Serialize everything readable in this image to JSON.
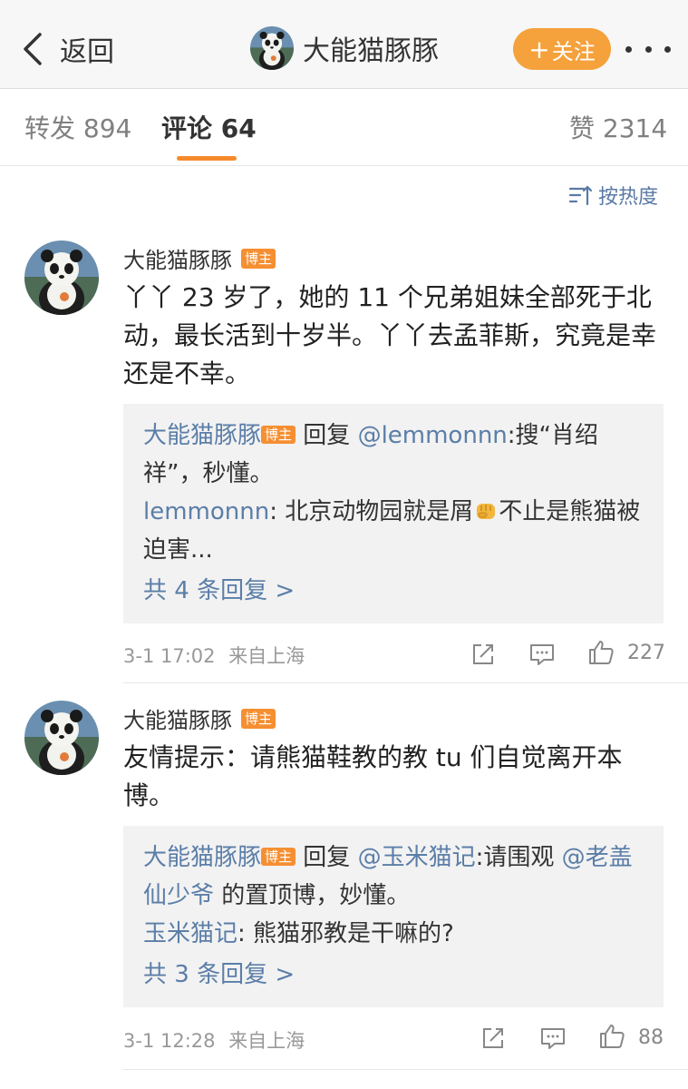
{
  "nav": {
    "back_label": "返回",
    "title": "大能猫豚豚",
    "follow_label": "关注",
    "follow_icon": "plus-icon",
    "more_icon": "more-icon"
  },
  "tabs": {
    "repost": "转发 894",
    "comment": "评论 64",
    "like": "赞 2314"
  },
  "sort": {
    "label": "按热度",
    "icon": "sort-icon"
  },
  "colors": {
    "accent": "#f5a13c",
    "link": "#5b7ea8",
    "badge": "#f68f32"
  },
  "comments": [
    {
      "author": "大能猫豚豚",
      "badge": "博主",
      "text": "丫丫 23 岁了，她的 11 个兄弟姐妹全部死于北动，最长活到十岁半。丫丫去孟菲斯，究竟是幸还是不幸。",
      "replies": [
        {
          "name": "大能猫豚豚",
          "badge": "博主",
          "reply_word": " 回复 ",
          "mention": "@lemmonnn",
          "text": ":搜“肖绍祥”，秒懂。"
        },
        {
          "name": "lemmonnn",
          "text_before": ": 北京动物园就是屑",
          "text_after": "不止是熊猫被迫害..."
        }
      ],
      "more_replies": "共 4 条回复 >",
      "time": "3-1 17:02",
      "source": "来自上海",
      "likes": "227"
    },
    {
      "author": "大能猫豚豚",
      "badge": "博主",
      "text": "友情提示：请熊猫鞋教的教 tu 们自觉离开本博。",
      "replies": [
        {
          "name": "大能猫豚豚",
          "badge": "博主",
          "reply_word": " 回复 ",
          "mention": "@玉米猫记",
          "text_mid": ":请围观 ",
          "mention2": "@老盖仙少爷",
          "text": " 的置顶博，妙懂。"
        },
        {
          "name": "玉米猫记",
          "text": ": 熊猫邪教是干嘛的?"
        }
      ],
      "more_replies": "共 3 条回复 >",
      "time": "3-1 12:28",
      "source": "来自上海",
      "likes": "88"
    }
  ]
}
